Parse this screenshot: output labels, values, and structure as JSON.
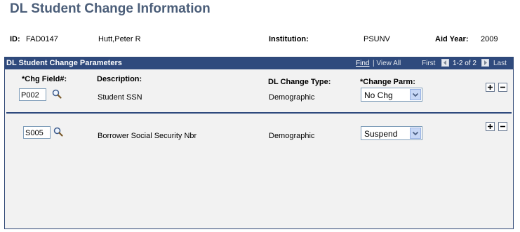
{
  "page": {
    "title": "DL Student Change Information"
  },
  "header": {
    "id_label": "ID:",
    "id_value": "FAD0147",
    "name": "Hutt,Peter R",
    "institution_label": "Institution:",
    "institution_value": "PSUNV",
    "aid_year_label": "Aid Year:",
    "aid_year_value": "2009"
  },
  "grid": {
    "title": "DL Student Change Parameters",
    "find": "Find",
    "view_all": "| View All",
    "first": "First",
    "range": "1-2 of 2",
    "last": "Last",
    "columns": {
      "chg_field": "*Chg Field#:",
      "description": "Description:",
      "dl_change_type": "DL Change Type:",
      "change_parm": "*Change Parm:"
    },
    "rows": [
      {
        "chg_field": "P002",
        "description": "Student SSN",
        "dl_change_type": "Demographic",
        "change_parm": "No Chg"
      },
      {
        "chg_field": "S005",
        "description": "Borrower Social Security Nbr",
        "dl_change_type": "Demographic",
        "change_parm": "Suspend"
      }
    ]
  },
  "icons": {
    "lookup": "magnifier-icon",
    "add": "plus-icon",
    "delete": "minus-icon",
    "prev": "chevron-left-icon",
    "next": "chevron-right-icon",
    "dropdown": "chevron-down-icon"
  },
  "colors": {
    "title": "#4b5e79",
    "grid_header": "#2f4a7d",
    "grid_body": "#f2f2f2"
  }
}
